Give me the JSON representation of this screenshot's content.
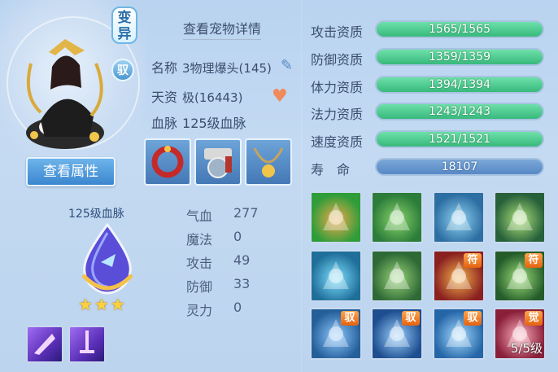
{
  "pet_tags": {
    "variant": "变异",
    "mount": "驭"
  },
  "left": {
    "view_attr_button": "查看属性",
    "bloodline_title": "125级血脉",
    "stars": "★★★",
    "star_count": 3
  },
  "center": {
    "detail_link": "查看宠物详情",
    "info": [
      {
        "label": "名称",
        "value": "3物理爆头(145)"
      },
      {
        "label": "天资",
        "value": "极(16443)"
      },
      {
        "label": "血脉",
        "value": "125级血脉"
      }
    ],
    "equipment": [
      "red-bracelet",
      "orb-bracer",
      "gold-necklace"
    ],
    "stats": [
      {
        "label": "气血",
        "value": "277"
      },
      {
        "label": "魔法",
        "value": "0"
      },
      {
        "label": "攻击",
        "value": "49"
      },
      {
        "label": "防御",
        "value": "33"
      },
      {
        "label": "灵力",
        "value": "0"
      }
    ]
  },
  "right": {
    "aptitudes": [
      {
        "label": "攻击资质",
        "value": "1565/1565",
        "fill": 1.0
      },
      {
        "label": "防御资质",
        "value": "1359/1359",
        "fill": 1.0
      },
      {
        "label": "体力资质",
        "value": "1394/1394",
        "fill": 1.0
      },
      {
        "label": "法力资质",
        "value": "1243/1243",
        "fill": 1.0
      },
      {
        "label": "速度资质",
        "value": "1521/1521",
        "fill": 1.0
      }
    ],
    "lifespan": {
      "label": "寿　命",
      "value": "18107"
    },
    "skills": [
      {
        "name": "flame-sword-skill",
        "badge": "",
        "level": ""
      },
      {
        "name": "power-body-skill",
        "badge": "",
        "level": ""
      },
      {
        "name": "shadow-figure-skill",
        "badge": "",
        "level": ""
      },
      {
        "name": "moon-warrior-skill",
        "badge": "",
        "level": ""
      },
      {
        "name": "blue-flame-skill",
        "badge": "",
        "level": ""
      },
      {
        "name": "giant-skill",
        "badge": "",
        "level": ""
      },
      {
        "name": "seal-strike-skill",
        "badge": "符",
        "level": ""
      },
      {
        "name": "seal-fist-skill",
        "badge": "符",
        "level": ""
      },
      {
        "name": "wind-kick-skill",
        "badge": "驭",
        "level": ""
      },
      {
        "name": "ice-sword-skill",
        "badge": "驭",
        "level": ""
      },
      {
        "name": "dash-skill",
        "badge": "驭",
        "level": ""
      },
      {
        "name": "awaken-skill",
        "badge": "觉",
        "level": "5/5级"
      }
    ]
  },
  "colors": {
    "bar_green": "#45c586",
    "bar_blue": "#6a97cf",
    "badge_orange": "#f07c22"
  }
}
